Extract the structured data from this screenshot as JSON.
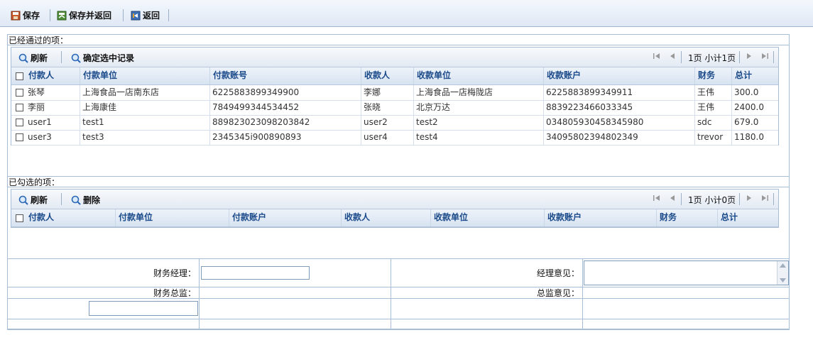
{
  "toolbar": {
    "save_label": "保存",
    "save_return_label": "保存并返回",
    "return_label": "返回"
  },
  "passed": {
    "title": "已经通过的项：",
    "refresh_label": "刷新",
    "confirm_label": "确定选中记录",
    "pager_text": "1页 小计1页",
    "columns": [
      "付款人",
      "付款单位",
      "付款账号",
      "收款人",
      "收款单位",
      "收款账户",
      "财务",
      "总计"
    ],
    "rows": [
      [
        "张琴",
        "上海食品一店南东店",
        "6225883899349900",
        "李娜",
        "上海食品一店梅陇店",
        "6225883899349911",
        "王伟",
        "300.0"
      ],
      [
        "李丽",
        "上海康佳",
        "7849499344534452",
        "张晓",
        "北京万达",
        "8839223466033345",
        "王伟",
        "2400.0"
      ],
      [
        "user1",
        "test1",
        "889823023098203842",
        "user2",
        "test2",
        "034805930458345980",
        "sdc",
        "679.0"
      ],
      [
        "user3",
        "test3",
        "2345345i900890893",
        "user4",
        "test4",
        "34095802394802349",
        "trevor",
        "1180.0"
      ]
    ]
  },
  "checked": {
    "title": "已勾选的项：",
    "refresh_label": "刷新",
    "delete_label": "删除",
    "pager_text": "1页 小计0页",
    "columns": [
      "付款人",
      "付款单位",
      "付款账户",
      "收款人",
      "收款单位",
      "收款账户",
      "财务",
      "总计"
    ]
  },
  "form": {
    "manager_label": "财务经理：",
    "manager_value": "",
    "manager_opinion_label": "经理意见：",
    "manager_opinion_value": "",
    "director_label": "财务总监：",
    "director_value": "",
    "director_opinion_label": "总监意见："
  },
  "colors": {
    "border": "#a6bdd7",
    "header_text": "#1a4a8a"
  }
}
